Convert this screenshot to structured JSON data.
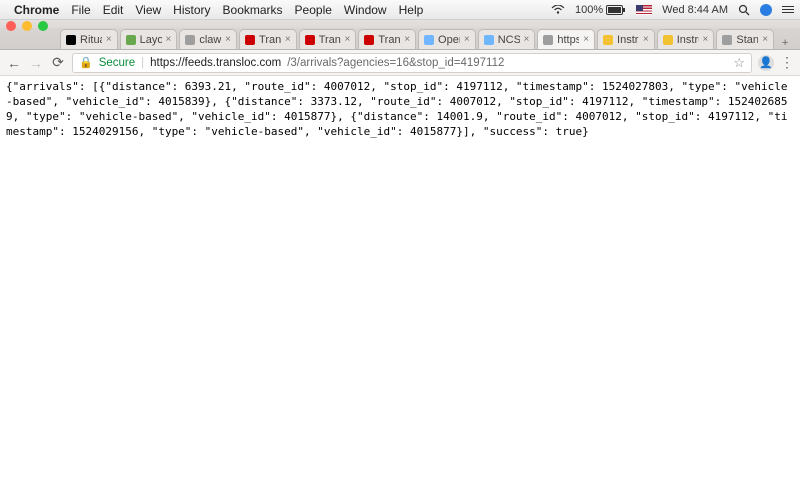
{
  "menubar": {
    "app": "Chrome",
    "items": [
      "File",
      "Edit",
      "View",
      "History",
      "Bookmarks",
      "People",
      "Window",
      "Help"
    ],
    "battery": "100%",
    "clock": "Wed 8:44 AM"
  },
  "tabs": [
    {
      "title": "Ritual",
      "fav": "#000000"
    },
    {
      "title": "Layout",
      "fav": "#6aa84f"
    },
    {
      "title": "clawbc",
      "fav": "#9e9e9e"
    },
    {
      "title": "Transf",
      "fav": "#cc0000"
    },
    {
      "title": "Transf",
      "fav": "#cc0000"
    },
    {
      "title": "Transf",
      "fav": "#cc0000"
    },
    {
      "title": "OpenA",
      "fav": "#6fb6ff"
    },
    {
      "title": "NCSU",
      "fav": "#6fb6ff"
    },
    {
      "title": "https:/",
      "fav": "#9e9e9e",
      "active": true
    },
    {
      "title": "Instruc",
      "fav": "#f1c232"
    },
    {
      "title": "Instruc",
      "fav": "#f1c232"
    },
    {
      "title": "Standa",
      "fav": "#9e9e9e"
    }
  ],
  "omnibox": {
    "secure_label": "Secure",
    "host": "https://feeds.transloc.com",
    "path": "/3/arrivals?agencies=16&stop_id=4197112"
  },
  "page_text": "{\"arrivals\": [{\"distance\": 6393.21, \"route_id\": 4007012, \"stop_id\": 4197112, \"timestamp\": 1524027803, \"type\": \"vehicle-based\", \"vehicle_id\": 4015839}, {\"distance\": 3373.12, \"route_id\": 4007012, \"stop_id\": 4197112, \"timestamp\": 1524026859, \"type\": \"vehicle-based\", \"vehicle_id\": 4015877}, {\"distance\": 14001.9, \"route_id\": 4007012, \"stop_id\": 4197112, \"timestamp\": 1524029156, \"type\": \"vehicle-based\", \"vehicle_id\": 4015877}], \"success\": true}"
}
